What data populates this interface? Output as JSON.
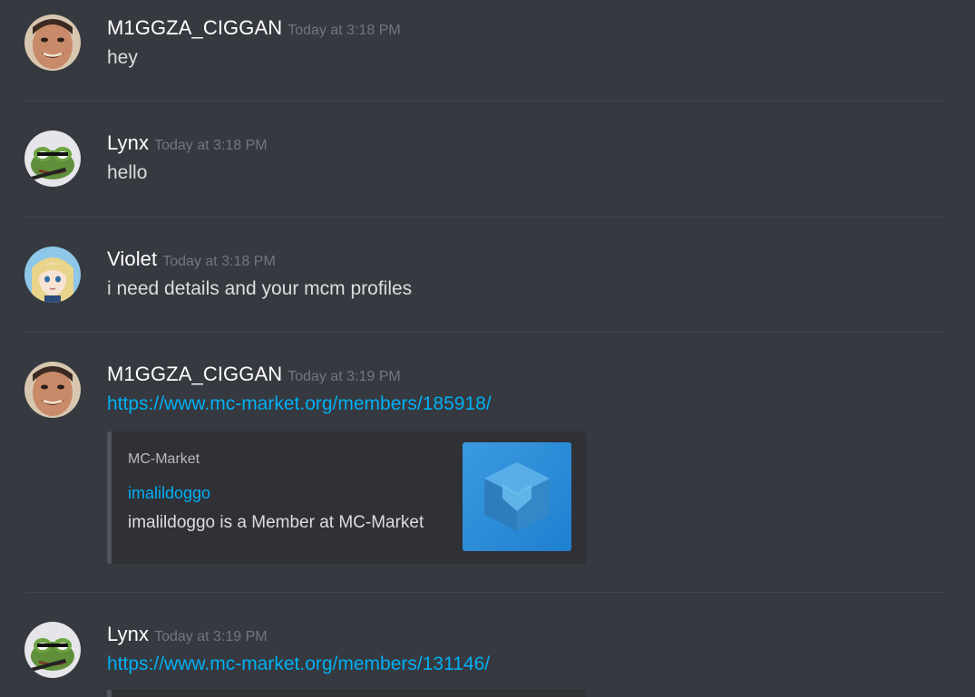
{
  "messages": [
    {
      "username": "M1GGZA_CIGGAN",
      "timestamp": "Today at 3:18 PM",
      "text": "hey",
      "avatar_icon": "smiling-man-avatar"
    },
    {
      "username": "Lynx",
      "timestamp": "Today at 3:18 PM",
      "text": "hello",
      "avatar_icon": "frog-avatar"
    },
    {
      "username": "Violet",
      "timestamp": "Today at 3:18 PM",
      "text": "i need details and your mcm profiles",
      "avatar_icon": "anime-girl-avatar"
    },
    {
      "username": "M1GGZA_CIGGAN",
      "timestamp": "Today at 3:19 PM",
      "link": "https://www.mc-market.org/members/185918/",
      "avatar_icon": "smiling-man-avatar",
      "embed": {
        "provider": "MC-Market",
        "title": "imalildoggo",
        "description": "imalildoggo is a Member at MC-Market",
        "thumbnail_icon": "mc-market-cube-logo"
      }
    },
    {
      "username": "Lynx",
      "timestamp": "Today at 3:19 PM",
      "link": "https://www.mc-market.org/members/131146/",
      "avatar_icon": "frog-avatar"
    }
  ],
  "colors": {
    "background": "#36393f",
    "username": "#ffffff",
    "timestamp": "#72767d",
    "message_text": "#dcddde",
    "link": "#00b0f4",
    "embed_background": "#2f3136",
    "embed_border": "#4f545c"
  }
}
